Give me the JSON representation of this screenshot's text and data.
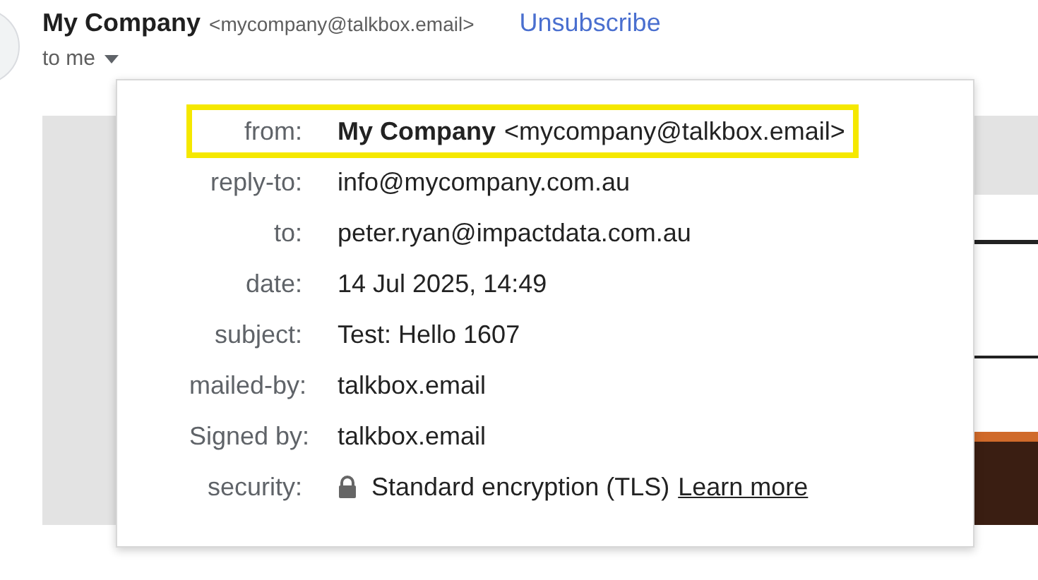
{
  "header": {
    "sender_name": "My Company",
    "sender_email": "<mycompany@talkbox.email>",
    "unsubscribe": "Unsubscribe",
    "recipient": "to me"
  },
  "details": [
    {
      "label": "from:",
      "name": "My Company",
      "value": "<mycompany@talkbox.email>",
      "highlighted": true
    },
    {
      "label": "reply-to:",
      "value": "info@mycompany.com.au",
      "highlighted": false
    },
    {
      "label": "to:",
      "value": "peter.ryan@impactdata.com.au",
      "highlighted": false
    },
    {
      "label": "date:",
      "value": "14 Jul 2025, 14:49",
      "highlighted": false
    },
    {
      "label": "subject:",
      "value": "Test: Hello 1607",
      "highlighted": false
    },
    {
      "label": "mailed-by:",
      "value": "talkbox.email",
      "highlighted": false
    },
    {
      "label": "Signed by:",
      "value": "talkbox.email",
      "highlighted": false
    },
    {
      "label": "security:",
      "value": "Standard encryption (TLS)",
      "link": "Learn more",
      "highlighted": false
    }
  ]
}
